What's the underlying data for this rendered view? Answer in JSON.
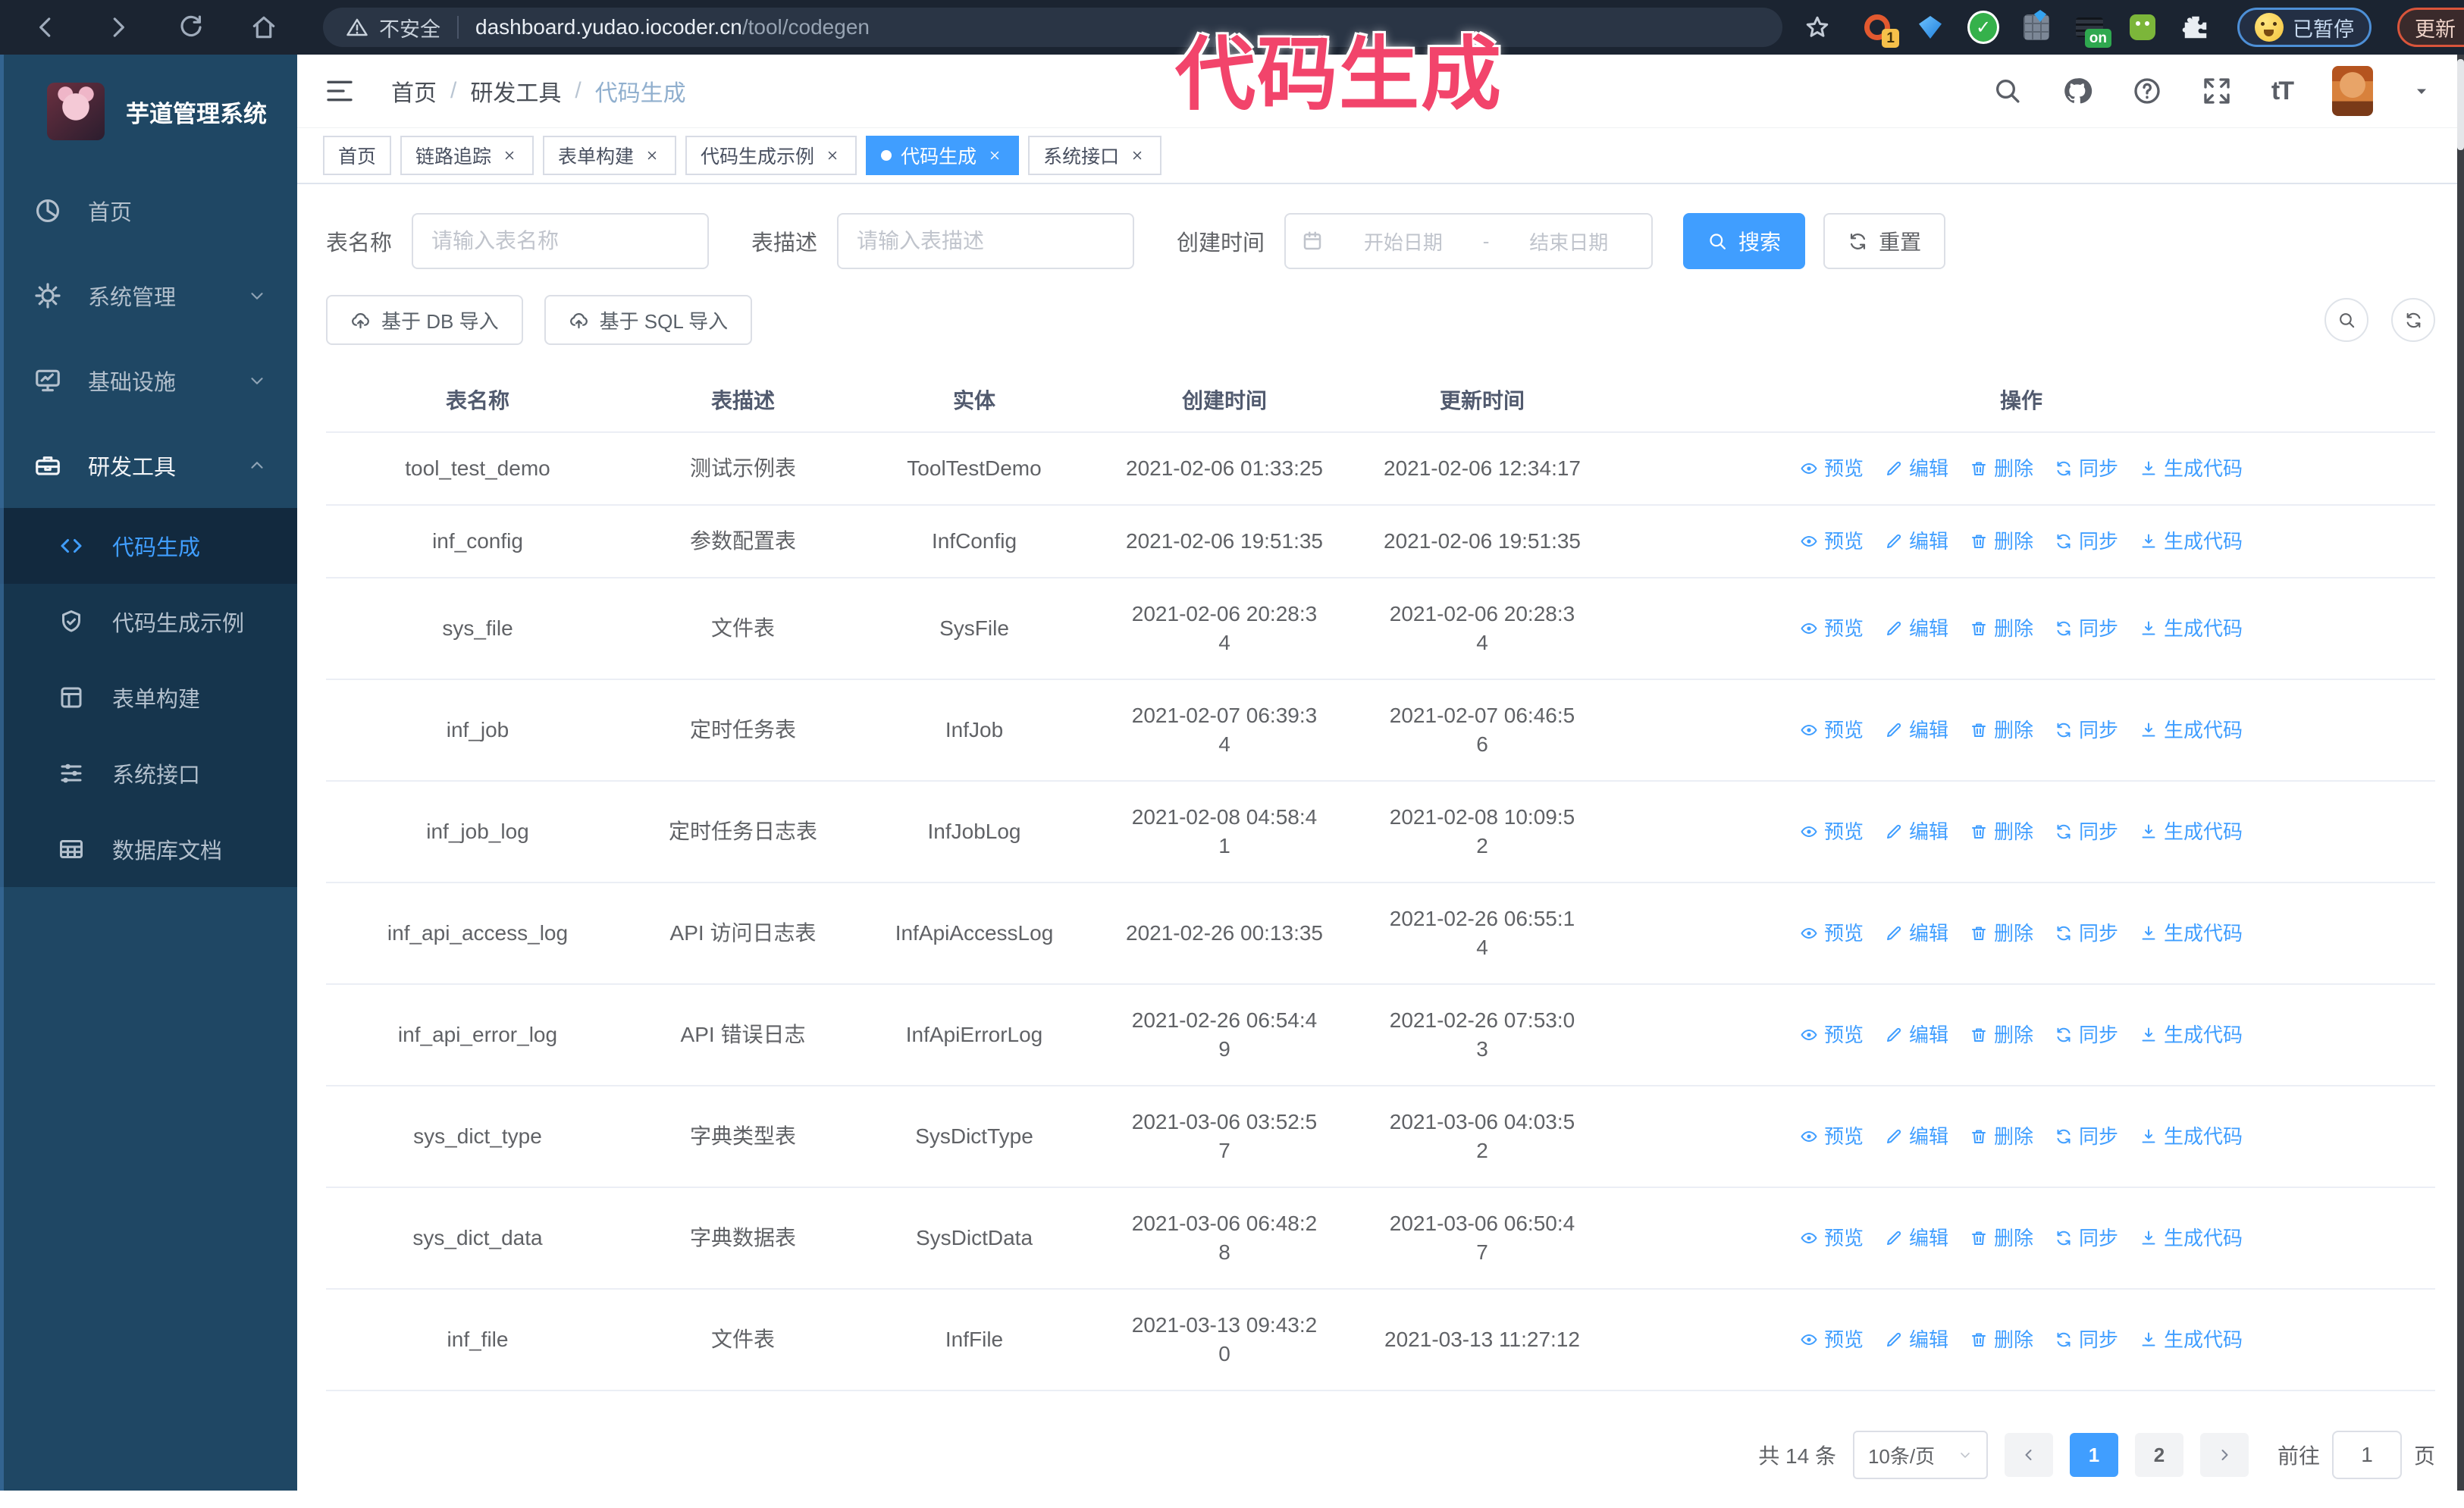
{
  "browser": {
    "security_label": "不安全",
    "url_domain": "dashboard.yudao.iocoder.cn",
    "url_path": "/tool/codegen",
    "extension_badge_1": "1",
    "extension_badge_on": "on",
    "paused_badge": "已暂停",
    "update_button": "更新"
  },
  "overlay": {
    "text": "代码生成",
    "color": "#F2446B"
  },
  "sidebar": {
    "title": "芋道管理系统",
    "items": [
      {
        "name": "home",
        "label": "首页",
        "icon": "dash",
        "chevron": null,
        "open": false
      },
      {
        "name": "system",
        "label": "系统管理",
        "icon": "gear",
        "chevron": "down",
        "open": false
      },
      {
        "name": "infra",
        "label": "基础设施",
        "icon": "monitor",
        "chevron": "down",
        "open": false
      },
      {
        "name": "dev-tools",
        "label": "研发工具",
        "icon": "tool",
        "chevron": "up",
        "open": true
      }
    ],
    "subitems": [
      {
        "name": "codegen",
        "label": "代码生成",
        "icon": "code",
        "active": true
      },
      {
        "name": "codegen-example",
        "label": "代码生成示例",
        "icon": "shield",
        "active": false
      },
      {
        "name": "form-build",
        "label": "表单构建",
        "icon": "form",
        "active": false
      },
      {
        "name": "system-api",
        "label": "系统接口",
        "icon": "sliders",
        "active": false
      },
      {
        "name": "db-doc",
        "label": "数据库文档",
        "icon": "grid",
        "active": false
      }
    ]
  },
  "breadcrumb": {
    "items": [
      "首页",
      "研发工具",
      "代码生成"
    ],
    "separator": "/"
  },
  "tabs": [
    {
      "label": "首页",
      "closable": false,
      "active": false
    },
    {
      "label": "链路追踪",
      "closable": true,
      "active": false
    },
    {
      "label": "表单构建",
      "closable": true,
      "active": false
    },
    {
      "label": "代码生成示例",
      "closable": true,
      "active": false
    },
    {
      "label": "代码生成",
      "closable": true,
      "active": true
    },
    {
      "label": "系统接口",
      "closable": true,
      "active": false
    }
  ],
  "filters": {
    "table_name_label": "表名称",
    "table_name_placeholder": "请输入表名称",
    "table_desc_label": "表描述",
    "table_desc_placeholder": "请输入表描述",
    "create_time_label": "创建时间",
    "date_start_placeholder": "开始日期",
    "date_separator": "-",
    "date_end_placeholder": "结束日期",
    "search_button": "搜索",
    "reset_button": "重置"
  },
  "toolbar": {
    "import_db_button": "基于 DB 导入",
    "import_sql_button": "基于 SQL 导入"
  },
  "table": {
    "columns": [
      "表名称",
      "表描述",
      "实体",
      "创建时间",
      "更新时间",
      "操作"
    ],
    "actions": [
      {
        "label": "预览",
        "icon": "eye"
      },
      {
        "label": "编辑",
        "icon": "edit"
      },
      {
        "label": "删除",
        "icon": "trash"
      },
      {
        "label": "同步",
        "icon": "refresh"
      },
      {
        "label": "生成代码",
        "icon": "download"
      }
    ],
    "rows": [
      {
        "name": "tool_test_demo",
        "desc": "测试示例表",
        "entity": "ToolTestDemo",
        "create": "2021-02-06 01:33:25",
        "update": "2021-02-06 12:34:17"
      },
      {
        "name": "inf_config",
        "desc": "参数配置表",
        "entity": "InfConfig",
        "create": "2021-02-06 19:51:35",
        "update": "2021-02-06 19:51:35"
      },
      {
        "name": "sys_file",
        "desc": "文件表",
        "entity": "SysFile",
        "create": "2021-02-06 20:28:3\n4",
        "update": "2021-02-06 20:28:3\n4"
      },
      {
        "name": "inf_job",
        "desc": "定时任务表",
        "entity": "InfJob",
        "create": "2021-02-07 06:39:3\n4",
        "update": "2021-02-07 06:46:5\n6"
      },
      {
        "name": "inf_job_log",
        "desc": "定时任务日志表",
        "entity": "InfJobLog",
        "create": "2021-02-08 04:58:4\n1",
        "update": "2021-02-08 10:09:5\n2"
      },
      {
        "name": "inf_api_access_log",
        "desc": "API 访问日志表",
        "entity": "InfApiAccessLog",
        "create": "2021-02-26 00:13:35",
        "update": "2021-02-26 06:55:1\n4"
      },
      {
        "name": "inf_api_error_log",
        "desc": "API 错误日志",
        "entity": "InfApiErrorLog",
        "create": "2021-02-26 06:54:4\n9",
        "update": "2021-02-26 07:53:0\n3"
      },
      {
        "name": "sys_dict_type",
        "desc": "字典类型表",
        "entity": "SysDictType",
        "create": "2021-03-06 03:52:5\n7",
        "update": "2021-03-06 04:03:5\n2"
      },
      {
        "name": "sys_dict_data",
        "desc": "字典数据表",
        "entity": "SysDictData",
        "create": "2021-03-06 06:48:2\n8",
        "update": "2021-03-06 06:50:4\n7"
      },
      {
        "name": "inf_file",
        "desc": "文件表",
        "entity": "InfFile",
        "create": "2021-03-13 09:43:2\n0",
        "update": "2021-03-13 11:27:12"
      }
    ]
  },
  "pagination": {
    "total": "共 14 条",
    "page_size": "10条/页",
    "pages": [
      "1",
      "2"
    ],
    "active_page": "1",
    "goto_label": "前往",
    "goto_value": "1",
    "page_suffix": "页"
  },
  "icons_text": {
    "font_size": "tT",
    "check": "✓",
    "dots": "⋮"
  },
  "colors": {
    "primary": "#409EFF",
    "sidebar_bg": "#1F4764",
    "submenu_bg": "#16354D",
    "chrome_bg": "#1B2431",
    "overlay_pink": "#F2446B"
  }
}
